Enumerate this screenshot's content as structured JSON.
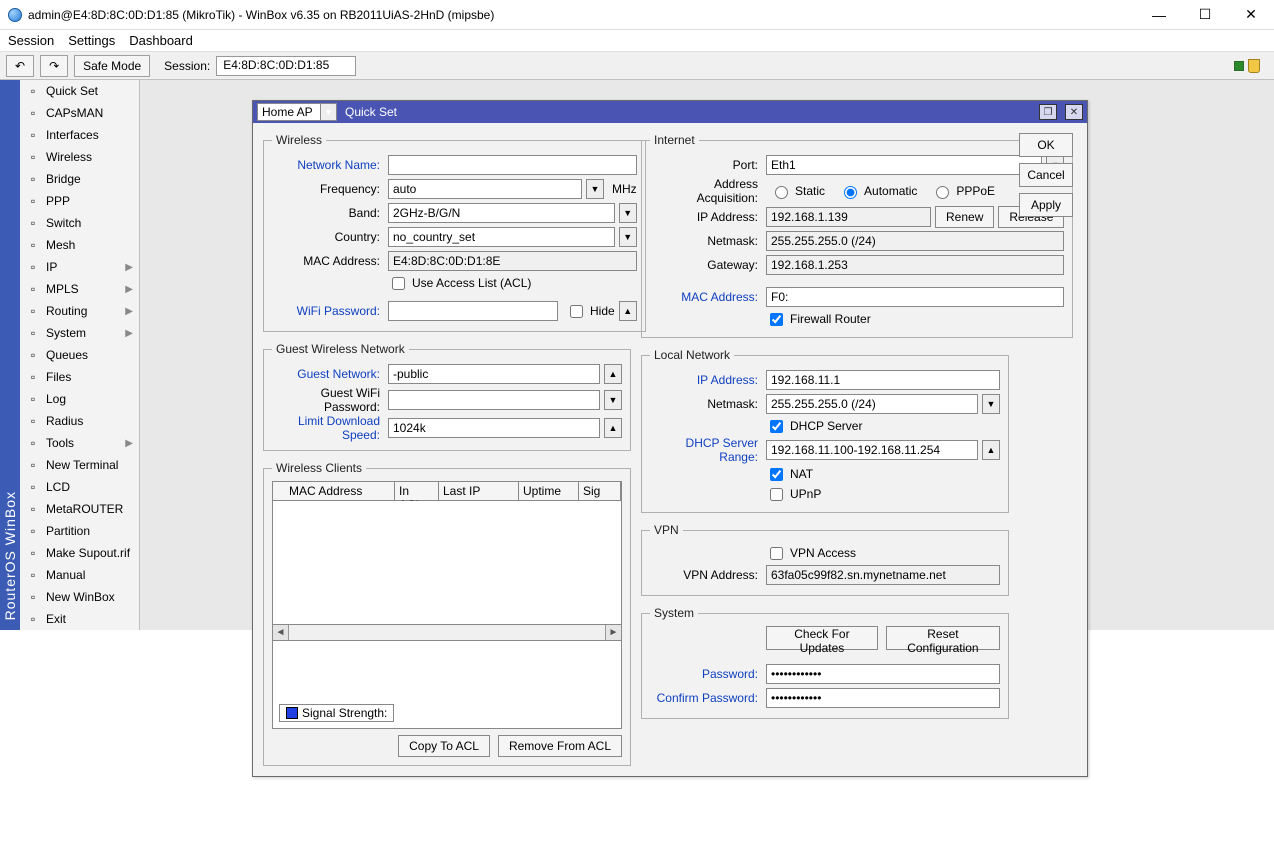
{
  "window": {
    "title": "admin@E4:8D:8C:0D:D1:85 (MikroTik) - WinBox v6.35 on RB2011UiAS-2HnD (mipsbe)"
  },
  "menubar": {
    "session": "Session",
    "settings": "Settings",
    "dashboard": "Dashboard"
  },
  "toolbar": {
    "safe_mode": "Safe Mode",
    "session_label": "Session:",
    "session_value": "E4:8D:8C:0D:D1:85"
  },
  "left_rail": "RouterOS WinBox",
  "sidebar": [
    "Quick Set",
    "CAPsMAN",
    "Interfaces",
    "Wireless",
    "Bridge",
    "PPP",
    "Switch",
    "Mesh",
    "IP",
    "MPLS",
    "Routing",
    "System",
    "Queues",
    "Files",
    "Log",
    "Radius",
    "Tools",
    "New Terminal",
    "LCD",
    "MetaROUTER",
    "Partition",
    "Make Supout.rif",
    "Manual",
    "New WinBox",
    "Exit"
  ],
  "sidebar_arrows": [
    "IP",
    "MPLS",
    "Routing",
    "System",
    "Tools"
  ],
  "qs": {
    "title_label": "Quick Set",
    "mode_value": "Home AP",
    "wireless": {
      "legend": "Wireless",
      "network_name_label": "Network Name:",
      "network_name_value": "",
      "frequency_label": "Frequency:",
      "frequency_value": "auto",
      "frequency_unit": "MHz",
      "band_label": "Band:",
      "band_value": "2GHz-B/G/N",
      "country_label": "Country:",
      "country_value": "no_country_set",
      "mac_label": "MAC Address:",
      "mac_value": "E4:8D:8C:0D:D1:8E",
      "acl_label": "Use Access List (ACL)",
      "wifi_pw_label": "WiFi Password:",
      "wifi_pw_value": "",
      "hide_label": "Hide"
    },
    "guest": {
      "legend": "Guest Wireless Network",
      "name_label": "Guest Network:",
      "name_value": "-public",
      "pw_label": "Guest WiFi Password:",
      "pw_value": "",
      "limit_label": "Limit Download Speed:",
      "limit_value": "1024k"
    },
    "clients": {
      "legend": "Wireless Clients",
      "col_mac": "MAC Address",
      "col_acl": "In ACL",
      "col_lastip": "Last IP",
      "col_uptime": "Uptime",
      "col_sig": "Sig",
      "signal_label": "Signal Strength:",
      "copy_acl": "Copy To ACL",
      "remove_acl": "Remove From ACL"
    },
    "internet": {
      "legend": "Internet",
      "port_label": "Port:",
      "port_value": "Eth1",
      "acq_label": "Address Acquisition:",
      "acq_static": "Static",
      "acq_auto": "Automatic",
      "acq_pppoe": "PPPoE",
      "ip_label": "IP Address:",
      "ip_value": "192.168.1.139",
      "renew": "Renew",
      "release": "Release",
      "netmask_label": "Netmask:",
      "netmask_value": "255.255.255.0 (/24)",
      "gateway_label": "Gateway:",
      "gateway_value": "192.168.1.253",
      "mac_label": "MAC Address:",
      "mac_value": "F0:",
      "firewall_label": "Firewall Router"
    },
    "local": {
      "legend": "Local Network",
      "ip_label": "IP Address:",
      "ip_value": "192.168.11.1",
      "netmask_label": "Netmask:",
      "netmask_value": "255.255.255.0 (/24)",
      "dhcp_server_label": "DHCP Server",
      "dhcp_range_label": "DHCP Server Range:",
      "dhcp_range_value": "192.168.11.100-192.168.11.254",
      "nat_label": "NAT",
      "upnp_label": "UPnP"
    },
    "vpn": {
      "legend": "VPN",
      "access_label": "VPN Access",
      "addr_label": "VPN Address:",
      "addr_value": "63fa05c99f82.sn.mynetname.net"
    },
    "system": {
      "legend": "System",
      "check_updates": "Check For Updates",
      "reset_conf": "Reset Configuration",
      "password_label": "Password:",
      "confirm_label": "Confirm Password:"
    },
    "buttons": {
      "ok": "OK",
      "cancel": "Cancel",
      "apply": "Apply"
    }
  }
}
